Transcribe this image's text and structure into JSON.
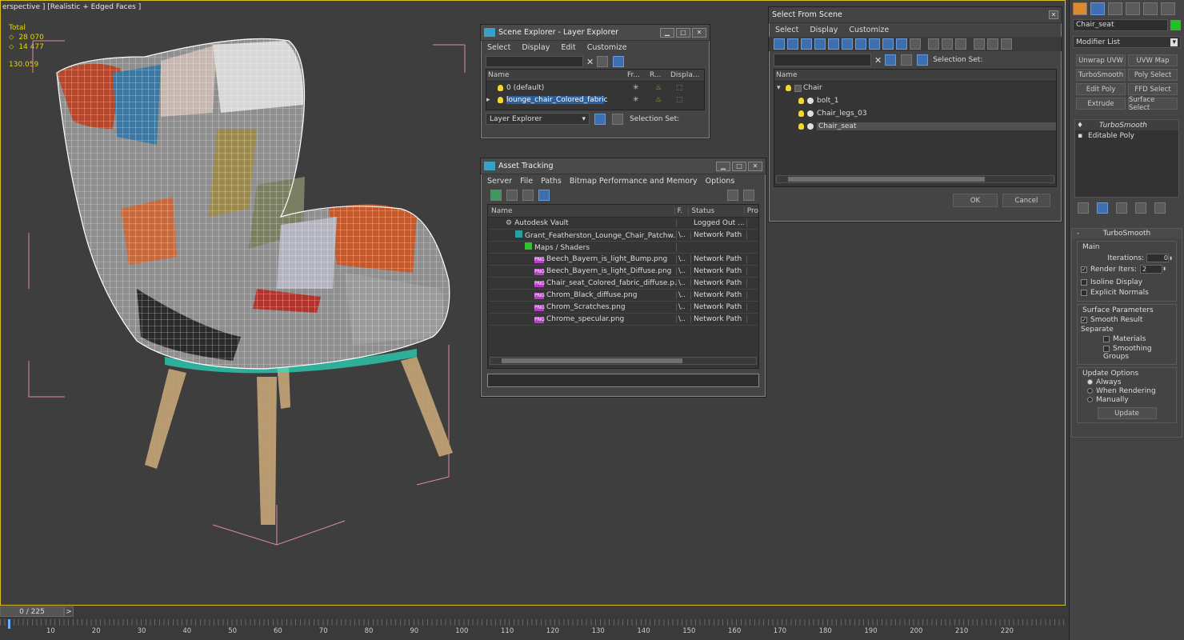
{
  "viewport": {
    "label": "erspective ] [Realistic + Edged Faces ]",
    "stats": {
      "total_label": "Total",
      "polys": "28 070",
      "verts": "14 477",
      "fps": "130.059"
    }
  },
  "layer_explorer": {
    "title": "Scene Explorer - Layer Explorer",
    "menu": [
      "Select",
      "Display",
      "Edit",
      "Customize"
    ],
    "columns": {
      "name": "Name",
      "frozen": "Fr...",
      "render": "R...",
      "display": "Displa..."
    },
    "rows": [
      {
        "label": "0 (default)"
      },
      {
        "label": "lounge_chair_Colored_fabric"
      }
    ],
    "footer_dropdown": "Layer Explorer",
    "selection_set": "Selection Set:"
  },
  "asset_tracking": {
    "title": "Asset Tracking",
    "menu": [
      "Server",
      "File",
      "Paths",
      "Bitmap Performance and Memory",
      "Options"
    ],
    "columns": {
      "name": "Name",
      "f": "F.",
      "status": "Status",
      "pro": "Pro"
    },
    "rows": [
      {
        "name": "Autodesk Vault",
        "f": "",
        "status": "Logged Out ..."
      },
      {
        "name": "Grant_Featherston_Lounge_Chair_Patchw...",
        "f": "\\..",
        "status": "Network Path"
      },
      {
        "name": "Maps / Shaders",
        "f": "",
        "status": ""
      },
      {
        "name": "Beech_Bayern_is_light_Bump.png",
        "f": "\\..",
        "status": "Network Path"
      },
      {
        "name": "Beech_Bayern_is_light_Diffuse.png",
        "f": "\\..",
        "status": "Network Path"
      },
      {
        "name": "Chair_seat_Colored_fabric_diffuse.p...",
        "f": "\\..",
        "status": "Network Path"
      },
      {
        "name": "Chrom_Black_diffuse.png",
        "f": "\\..",
        "status": "Network Path"
      },
      {
        "name": "Chrom_Scratches.png",
        "f": "\\..",
        "status": "Network Path"
      },
      {
        "name": "Chrome_specular.png",
        "f": "\\..",
        "status": "Network Path"
      }
    ]
  },
  "select_from_scene": {
    "title": "Select From Scene",
    "menu": [
      "Select",
      "Display",
      "Customize"
    ],
    "selection_set": "Selection Set:",
    "column_name": "Name",
    "tree": [
      {
        "label": "Chair"
      },
      {
        "label": "bolt_1"
      },
      {
        "label": "Chair_legs_03"
      },
      {
        "label": "Chair_seat"
      }
    ],
    "ok": "OK",
    "cancel": "Cancel"
  },
  "command_panel": {
    "object_name": "Chair_seat",
    "modifier_list": "Modifier List",
    "buttons": [
      "Unwrap UVW",
      "UVW Map",
      "TurboSmooth",
      "Poly Select",
      "Edit Poly",
      "FFD Select",
      "Extrude",
      "Surface Select"
    ],
    "stack": [
      "TurboSmooth",
      "Editable Poly"
    ],
    "rollout_title": "TurboSmooth",
    "main_label": "Main",
    "iterations_label": "Iterations:",
    "iterations_value": "0",
    "render_iters_label": "Render Iters:",
    "render_iters_value": "2",
    "isoline_display": "Isoline Display",
    "explicit_normals": "Explicit Normals",
    "surface_params": "Surface Parameters",
    "smooth_result": "Smooth Result",
    "separate": "Separate",
    "materials": "Materials",
    "smoothing_groups": "Smoothing Groups",
    "update_options": "Update Options",
    "always": "Always",
    "when_rendering": "When Rendering",
    "manually": "Manually",
    "update_button": "Update"
  },
  "timeline": {
    "frame_counter": "0 / 225",
    "next": ">",
    "ticks": [
      "10",
      "20",
      "30",
      "40",
      "50",
      "60",
      "70",
      "80",
      "90",
      "100",
      "110",
      "120",
      "130",
      "140",
      "150",
      "160",
      "170",
      "180",
      "190",
      "200",
      "210",
      "220"
    ]
  },
  "colors": {
    "accent": "#2a5fa0",
    "viewport_border": "#d8c020",
    "object_color": "#22c022"
  }
}
